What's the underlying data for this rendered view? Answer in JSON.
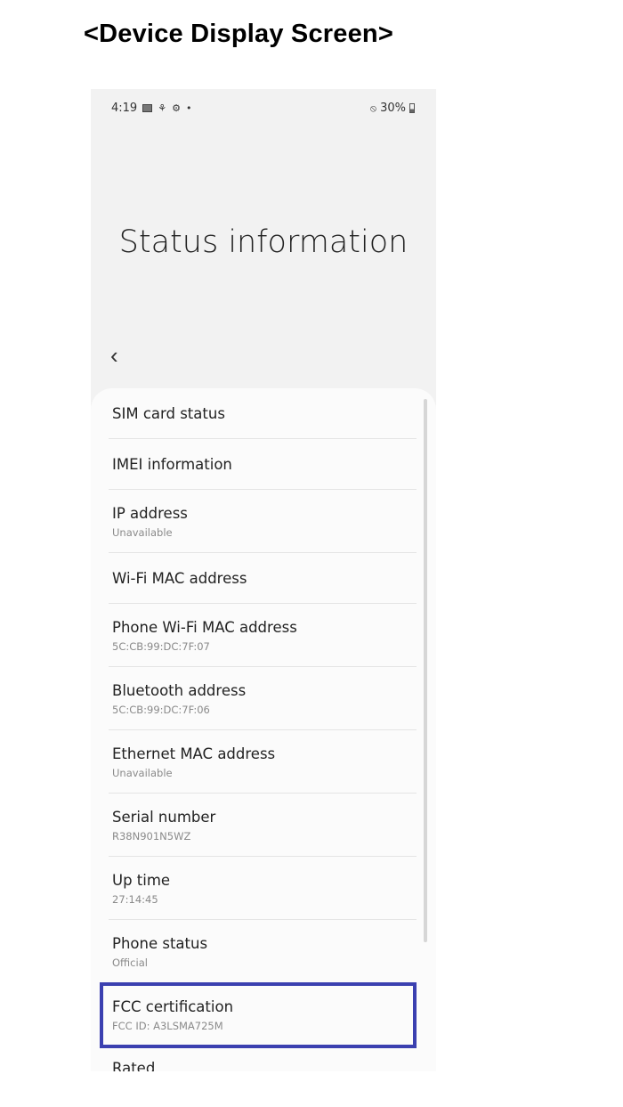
{
  "document": {
    "title": "<Device Display Screen>"
  },
  "status_bar": {
    "time": "4:19",
    "left_icons": [
      "gallery-icon",
      "sync-icon",
      "settings-icon",
      "dot-icon"
    ],
    "right_icons": [
      "do-not-disturb-icon",
      "battery-icon"
    ],
    "battery": "30%"
  },
  "header": {
    "title": "Status information",
    "back_icon": "chevron-left-icon"
  },
  "items": [
    {
      "title": "SIM card status",
      "subtitle": null
    },
    {
      "title": "IMEI information",
      "subtitle": null
    },
    {
      "title": "IP address",
      "subtitle": "Unavailable"
    },
    {
      "title": "Wi-Fi MAC address",
      "subtitle": null
    },
    {
      "title": "Phone Wi-Fi MAC address",
      "subtitle": "5C:CB:99:DC:7F:07"
    },
    {
      "title": "Bluetooth address",
      "subtitle": "5C:CB:99:DC:7F:06"
    },
    {
      "title": "Ethernet MAC address",
      "subtitle": "Unavailable"
    },
    {
      "title": "Serial number",
      "subtitle": "R38N901N5WZ"
    },
    {
      "title": "Up time",
      "subtitle": "27:14:45"
    },
    {
      "title": "Phone status",
      "subtitle": "Official"
    },
    {
      "title": "FCC certification",
      "subtitle": "FCC ID: A3LSMA725M"
    },
    {
      "title": "Rated",
      "subtitle": null
    }
  ],
  "highlight": {
    "color": "#3b40b0",
    "target": "FCC certification"
  }
}
